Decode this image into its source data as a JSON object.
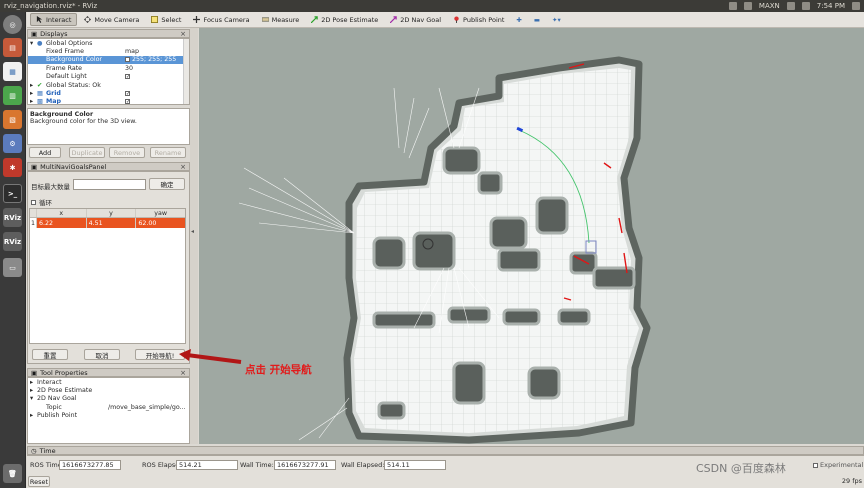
{
  "window": {
    "title": "rviz_navigation.rviz* - RViz"
  },
  "system_tray": {
    "ime": "MAXN",
    "clock": "7:54 PM"
  },
  "launcher": {
    "items": [
      "dash",
      "files",
      "docs",
      "spreadsheet",
      "presentation",
      "settings-sw",
      "system-settings",
      "terminal",
      "rviz-1",
      "rviz-2",
      "drive",
      "trash"
    ],
    "rviz_label": "RViz"
  },
  "toolbar": {
    "tools": [
      "Interact",
      "Move Camera",
      "Select",
      "Focus Camera",
      "Measure",
      "2D Pose Estimate",
      "2D Nav Goal",
      "Publish Point"
    ],
    "active_tool": "Interact"
  },
  "displays_panel": {
    "title": "Displays",
    "rows": [
      {
        "key": "Global Options",
        "value": ""
      },
      {
        "key": "Fixed Frame",
        "value": "map"
      },
      {
        "key": "Background Color",
        "value": "255; 255; 255"
      },
      {
        "key": "Frame Rate",
        "value": "30"
      },
      {
        "key": "Default Light",
        "value": "✓"
      },
      {
        "key": "Global Status: Ok",
        "value": ""
      },
      {
        "key": "Grid",
        "value": "✓"
      },
      {
        "key": "Map",
        "value": "✓"
      }
    ],
    "description_title": "Background Color",
    "description_text": "Background color for the 3D view.",
    "buttons": [
      "Add",
      "Duplicate",
      "Remove",
      "Rename"
    ]
  },
  "multinav_panel": {
    "title": "MultiNaviGoalsPanel",
    "max_goals_label": "目标最大数量",
    "confirm_label": "确定",
    "loop_label": "循环",
    "table": {
      "columns": [
        "x",
        "y",
        "yaw"
      ],
      "rows": [
        {
          "index": "1",
          "x": "6.22",
          "y": "4.51",
          "yaw": "62.00"
        }
      ]
    },
    "reset_label": "重置",
    "cancel_label": "取消",
    "start_label": "开始导航!"
  },
  "tool_properties": {
    "title": "Tool Properties",
    "rows": [
      {
        "key": "Interact",
        "value": ""
      },
      {
        "key": "2D Pose Estimate",
        "value": ""
      },
      {
        "key": "2D Nav Goal",
        "value": ""
      },
      {
        "key": "Topic",
        "value": "/move_base_simple/go..."
      },
      {
        "key": "Publish Point",
        "value": ""
      }
    ]
  },
  "annotation": {
    "text": "点击  开始导航"
  },
  "time_panel": {
    "title": "Time",
    "ros_time_label": "ROS Time:",
    "ros_time": "1616673277.85",
    "ros_elapsed_label": "ROS Elapsed:",
    "ros_elapsed": "514.21",
    "wall_time_label": "Wall Time:",
    "wall_time": "1616673277.91",
    "wall_elapsed_label": "Wall Elapsed:",
    "wall_elapsed": "514.11",
    "experimental_label": "Experimental",
    "reset_label": "Reset",
    "fps": "29 fps"
  },
  "watermark": "CSDN @百度森林",
  "colors": {
    "accent": "#e95420",
    "selection": "#5a95d6",
    "annotation": "#e21b1b",
    "view_bg": "#9fa8a2"
  }
}
